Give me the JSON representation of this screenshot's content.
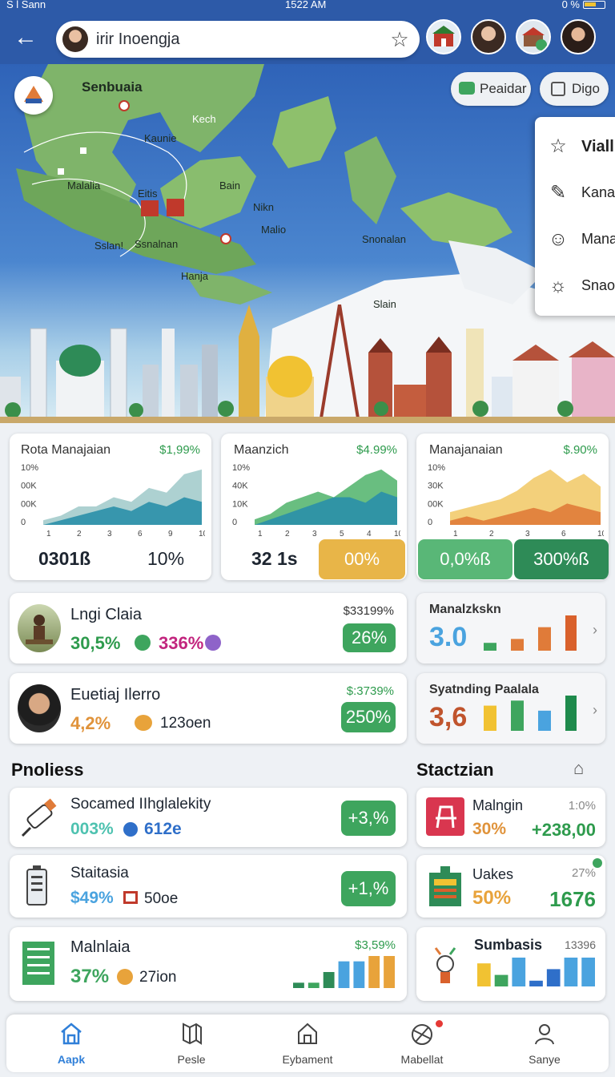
{
  "status_bar": {
    "left": "S l Sann",
    "time": "1522 AM",
    "right": "0 %"
  },
  "top_bar": {
    "search_value": "irir Inoengja"
  },
  "map": {
    "labels": [
      "Senbuaia",
      "Kech",
      "Kaunie",
      "Malalia",
      "Eitis",
      "Bain",
      "Nikn",
      "Malio",
      "Sslan!",
      "Ssnalnan",
      "Hanja",
      "Snonalan",
      "Slain"
    ],
    "buttons": {
      "left": "Peaidar",
      "right": "Digo"
    },
    "dropdown": [
      {
        "label": "Viall",
        "icon": "star-icon"
      },
      {
        "label": "Kana",
        "icon": "edit-icon"
      },
      {
        "label": "Mana",
        "icon": "chat-icon"
      },
      {
        "label": "Snao",
        "icon": "sun-icon"
      }
    ]
  },
  "chart_cards": [
    {
      "title": "Rota Manajaian",
      "value": "$1,99%",
      "ylabels": [
        "10%",
        "00K",
        "00K",
        "0"
      ],
      "xlabels": [
        "1",
        "2",
        "3",
        "6",
        "9",
        "10"
      ],
      "stat_left": "0301ß",
      "stat_right": "10%",
      "chart_data": {
        "type": "area",
        "x": [
          1,
          2,
          3,
          4,
          5,
          6,
          7,
          8,
          9,
          10
        ],
        "series": [
          {
            "values": [
              1,
              2,
              4,
              4,
              6,
              5,
              8,
              7,
              11,
              12
            ]
          },
          {
            "values": [
              0,
              1,
              2,
              3,
              4,
              3,
              5,
              4,
              6,
              5
            ]
          }
        ]
      }
    },
    {
      "title": "Maanzich",
      "value": "$4.99%",
      "ylabels": [
        "10%",
        "40K",
        "10K",
        "0"
      ],
      "xlabels": [
        "1",
        "2",
        "3",
        "5",
        "4",
        "10"
      ],
      "stat_left": "32 1s",
      "stat_right": "00%",
      "chart_data": {
        "type": "area",
        "x": [
          1,
          2,
          3,
          4,
          5,
          6,
          7,
          8,
          9,
          10
        ],
        "series": [
          {
            "values": [
              1,
              2,
              4,
              5,
              6,
              5,
              7,
              9,
              10,
              8
            ]
          },
          {
            "values": [
              0,
              1,
              2,
              3,
              4,
              5,
              5,
              4,
              6,
              5
            ]
          }
        ]
      }
    },
    {
      "title": "Manajanaian",
      "value": "$.90%",
      "ylabels": [
        "10%",
        "30K",
        "00K",
        "0"
      ],
      "xlabels": [
        "1",
        "2",
        "3",
        "6",
        "10"
      ],
      "stat_left": "0,0%ß",
      "stat_right": "300%ß",
      "chart_data": {
        "type": "area",
        "x": [
          1,
          2,
          3,
          4,
          5,
          6,
          7,
          8,
          9,
          10
        ],
        "series": [
          {
            "values": [
              3,
              4,
              5,
              6,
              8,
              11,
              13,
              10,
              12,
              9
            ]
          },
          {
            "values": [
              1,
              2,
              1,
              2,
              3,
              4,
              3,
              5,
              4,
              3
            ]
          }
        ]
      }
    }
  ],
  "people": [
    {
      "name": "Lngi Claia",
      "amount": "$33199%",
      "stat1": "30,5%",
      "stat2": "336%",
      "chip": "26%"
    },
    {
      "name": "Euetiaj Ilerro",
      "amount": "$:3739%",
      "stat1": "4,2%",
      "stat2": "123oen",
      "chip": "250%"
    }
  ],
  "mini_cards": [
    {
      "title": "Manalzkskn",
      "value": "3.0",
      "bars": [
        2,
        3,
        6,
        9
      ],
      "colors": [
        "#3ea55e",
        "#e07b39",
        "#e07b39",
        "#d9612c"
      ]
    },
    {
      "title": "Syatnding Paalala",
      "value": "3,6",
      "bars": [
        5,
        6,
        4,
        7
      ],
      "colors": [
        "#f1c232",
        "#3ea55e",
        "#4aa3df",
        "#1e8a4c"
      ]
    }
  ],
  "section_left": "Pnoliess",
  "section_right": "Stactzian",
  "list_left": [
    {
      "title": "Socamed IIhglalekity",
      "stat1": "003%",
      "stat2": "612e",
      "chip": "+3,%"
    },
    {
      "title": "Staitasia",
      "stat1": "$49%",
      "stat2": "50oe",
      "chip": "+1,%"
    },
    {
      "title": "Malnlaia",
      "amount": "$3,59%",
      "stat1": "37%",
      "stat2": "27ion",
      "bars": [
        1,
        1,
        3,
        5,
        5,
        6,
        6
      ]
    }
  ],
  "list_right": [
    {
      "title": "Malngin",
      "amount": "1:0%",
      "stat1": "30%",
      "stat2": "+238,00"
    },
    {
      "title": "Uakes",
      "amount": "27%",
      "stat1": "50%",
      "stat2": "1676"
    },
    {
      "title": "Sumbasis",
      "amount": "13396",
      "bars": [
        4,
        2,
        5,
        1,
        3,
        5,
        5
      ]
    }
  ],
  "bottom_nav": [
    {
      "label": "Aapk",
      "icon": "home-icon",
      "active": true
    },
    {
      "label": "Pesle",
      "icon": "map-icon"
    },
    {
      "label": "Eybament",
      "icon": "building-icon"
    },
    {
      "label": "Mabellat",
      "icon": "ball-icon"
    },
    {
      "label": "Sanye",
      "icon": "person-icon"
    }
  ]
}
